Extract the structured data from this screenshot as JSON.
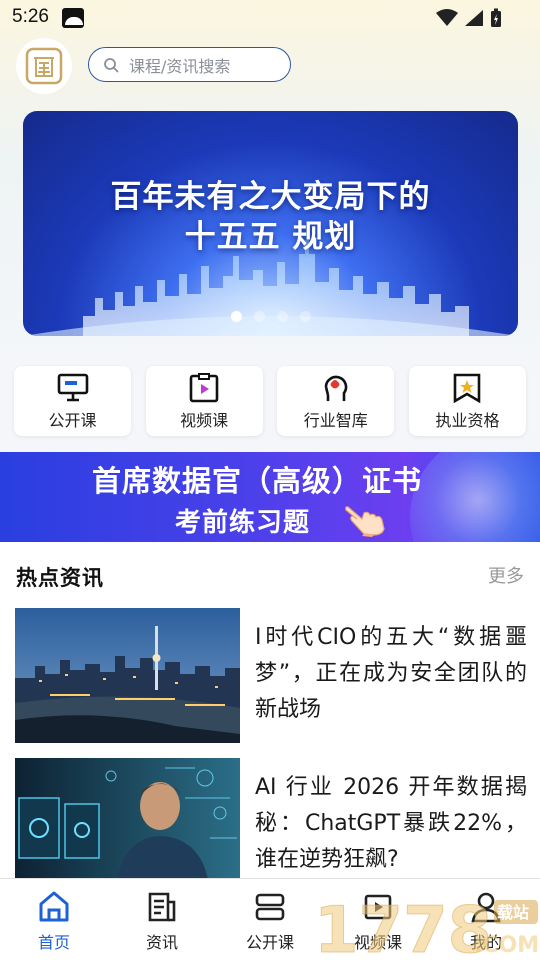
{
  "status_bar": {
    "time": "5:26"
  },
  "header": {
    "logo_icon": "seal-logo-icon",
    "search": {
      "placeholder": "课程/资讯搜索",
      "icon": "search-icon"
    }
  },
  "banner": {
    "line1": "百年未有之大变局下的",
    "line2": "十五五 规划",
    "slide_count": 4,
    "active_slide": 1
  },
  "quick_menu": {
    "items": [
      {
        "label": "公开课",
        "icon": "presentation-icon"
      },
      {
        "label": "视频课",
        "icon": "video-clipboard-icon"
      },
      {
        "label": "行业智库",
        "icon": "brain-head-icon"
      },
      {
        "label": "执业资格",
        "icon": "star-badge-icon"
      }
    ]
  },
  "promo": {
    "line1": "首席数据官（高级）证书",
    "line2": "考前练习题"
  },
  "news": {
    "title": "热点资讯",
    "more": "更多",
    "items": [
      {
        "title": "I时代CIO的五大“数据噩梦”，正在成为安全团队的新战场",
        "thumb": "city-night-skyline-photo"
      },
      {
        "title": "AI 行业 2026 开年数据揭秘：ChatGPT暴跌22%，谁在逆势狂飙?",
        "thumb": "man-at-computer-photo"
      }
    ]
  },
  "bottom_nav": {
    "items": [
      {
        "label": "首页",
        "icon": "home-icon",
        "active": true
      },
      {
        "label": "资讯",
        "icon": "news-icon",
        "active": false
      },
      {
        "label": "公开课",
        "icon": "course-stack-icon",
        "active": false
      },
      {
        "label": "视频课",
        "icon": "video-icon",
        "active": false
      },
      {
        "label": "我的",
        "icon": "person-icon",
        "active": false
      }
    ]
  },
  "watermark": {
    "text": "1778",
    "suffix": ".COM",
    "badge": "载站"
  },
  "colors": {
    "accent": "#1c62d6",
    "search_border": "#2b57a8",
    "banner_blue": "#1c3ab9"
  }
}
